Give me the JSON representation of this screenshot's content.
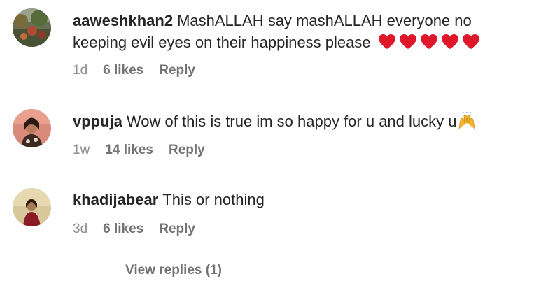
{
  "comments": [
    {
      "username": "aaweshkhan2",
      "text": "MashALLAH say mashALLAH everyone no keeping evil eyes on their happiness please",
      "emoji": [
        "red-heart",
        "red-heart",
        "red-heart",
        "red-heart",
        "red-heart"
      ],
      "time": "1d",
      "likes": "6 likes",
      "reply": "Reply"
    },
    {
      "username": "vppuja",
      "text": "Wow of this is true im so happy for u and lucky u",
      "emoji": [
        "raising-hands"
      ],
      "time": "1w",
      "likes": "14 likes",
      "reply": "Reply"
    },
    {
      "username": "khadijabear",
      "text": "This or nothing",
      "time": "3d",
      "likes": "6 likes",
      "reply": "Reply"
    }
  ],
  "view_replies": "View replies (1)"
}
